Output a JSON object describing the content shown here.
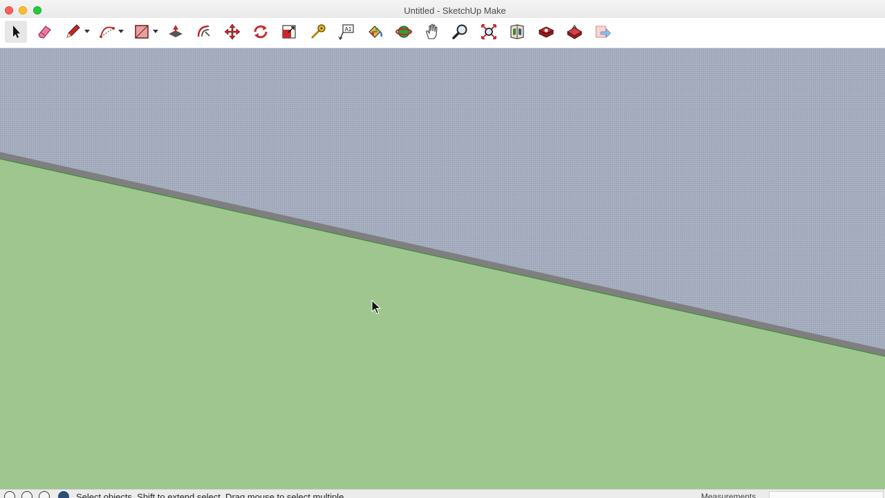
{
  "window": {
    "title": "Untitled - SketchUp Make",
    "buttons": [
      "close",
      "minimize",
      "maximize"
    ]
  },
  "toolbar": {
    "tools": [
      {
        "name": "select-tool",
        "icon": "arrow-pointer-icon",
        "selected": true
      },
      {
        "name": "eraser-tool",
        "icon": "eraser-icon"
      },
      {
        "name": "line-tool",
        "icon": "pencil-icon",
        "has_dropdown": true
      },
      {
        "name": "arc-tool",
        "icon": "arc-icon",
        "has_dropdown": true
      },
      {
        "name": "shapes-tool",
        "icon": "rectangle-icon",
        "has_dropdown": true
      },
      {
        "name": "push-pull-tool",
        "icon": "push-pull-icon"
      },
      {
        "name": "offset-tool",
        "icon": "offset-icon"
      },
      {
        "name": "move-tool",
        "icon": "move-icon"
      },
      {
        "name": "rotate-tool",
        "icon": "rotate-icon"
      },
      {
        "name": "scale-tool",
        "icon": "scale-icon"
      },
      {
        "name": "tape-measure-tool",
        "icon": "tape-measure-icon"
      },
      {
        "name": "text-tool",
        "icon": "text-icon"
      },
      {
        "name": "paint-bucket-tool",
        "icon": "paint-bucket-icon"
      },
      {
        "name": "orbit-tool",
        "icon": "orbit-icon"
      },
      {
        "name": "pan-tool",
        "icon": "hand-icon"
      },
      {
        "name": "zoom-tool",
        "icon": "magnifier-icon"
      },
      {
        "name": "zoom-extents-tool",
        "icon": "zoom-extents-icon"
      },
      {
        "name": "3d-warehouse-button",
        "icon": "warehouse-icon"
      },
      {
        "name": "extension-warehouse-button",
        "icon": "extension-icon"
      },
      {
        "name": "layout-button",
        "icon": "layout-icon"
      },
      {
        "name": "send-to-layout-button",
        "icon": "send-icon"
      }
    ]
  },
  "colors": {
    "sky": "#a5adbf",
    "ground": "#9fc68e",
    "horizon": "#7a7a7a",
    "accent_red": "#d42a2a"
  },
  "statusbar": {
    "message": "Select objects. Shift to extend select. Drag mouse to select multiple.",
    "measurements_label": "Measurements",
    "measurements_value": ""
  }
}
